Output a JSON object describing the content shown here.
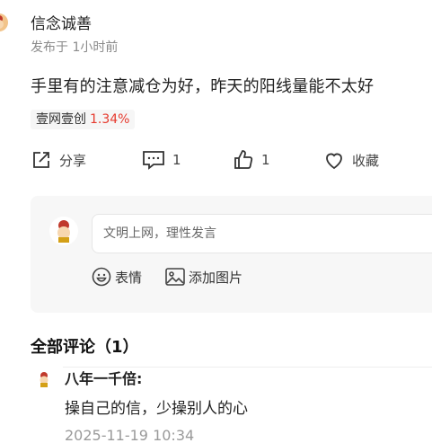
{
  "post": {
    "author": "信念诚善",
    "time": "发布于 1小时前",
    "content": "手里有的注意减仓为好，昨天的阳线量能不太好",
    "stock": {
      "name": "壹网壹创",
      "change": "1.34%"
    }
  },
  "actions": {
    "share": "分享",
    "comment_count": "1",
    "like_count": "1",
    "favorite": "收藏"
  },
  "reply": {
    "placeholder": "文明上网，理性发言",
    "emoji_label": "表情",
    "image_label": "添加图片"
  },
  "comments": {
    "title": "全部评论（1）",
    "items": [
      {
        "user": "八年一千倍:",
        "text": "操自己的信，少操别人的心",
        "time": "2025-11-19 10:34"
      }
    ]
  },
  "colors": {
    "stock_up": "#e63a2e",
    "muted": "#9a9a9a"
  }
}
